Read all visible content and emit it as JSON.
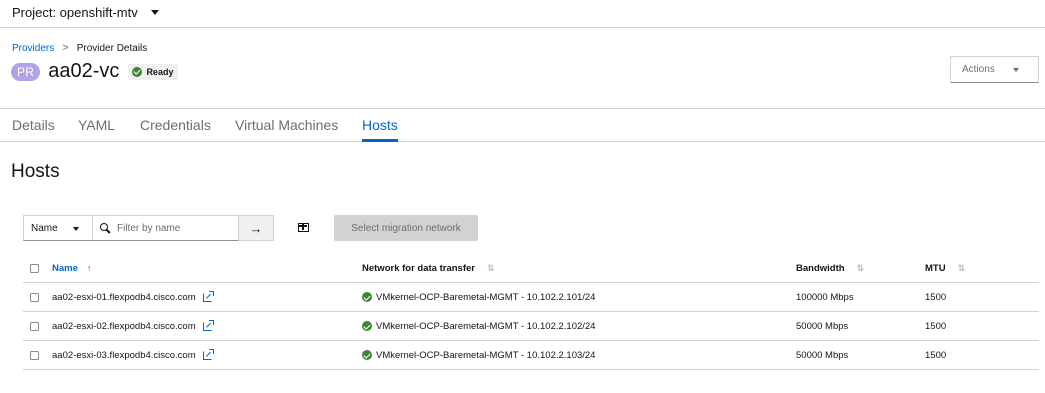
{
  "project": {
    "label": "Project: openshift-mtv"
  },
  "breadcrumb": {
    "link": "Providers",
    "separator": ">",
    "current": "Provider Details"
  },
  "header": {
    "badge": "PR",
    "title": "aa02-vc",
    "status": "Ready",
    "actions_label": "Actions"
  },
  "tabs": [
    {
      "label": "Details"
    },
    {
      "label": "YAML"
    },
    {
      "label": "Credentials"
    },
    {
      "label": "Virtual Machines"
    },
    {
      "label": "Hosts",
      "active": true
    }
  ],
  "section_title": "Hosts",
  "toolbar": {
    "filter_select": "Name",
    "filter_placeholder": "Filter by name",
    "submit_symbol": "→",
    "migrate_button": "Select migration network"
  },
  "table": {
    "columns": [
      "Name",
      "Network for data transfer",
      "Bandwidth",
      "MTU"
    ],
    "rows": [
      {
        "name": "aa02-esxi-01.flexpodb4.cisco.com",
        "network": "VMkernel-OCP-Baremetal-MGMT - 10.102.2.101/24",
        "bandwidth": "100000 Mbps",
        "mtu": "1500"
      },
      {
        "name": "aa02-esxi-02.flexpodb4.cisco.com",
        "network": "VMkernel-OCP-Baremetal-MGMT - 10.102.2.102/24",
        "bandwidth": "50000 Mbps",
        "mtu": "1500"
      },
      {
        "name": "aa02-esxi-03.flexpodb4.cisco.com",
        "network": "VMkernel-OCP-Baremetal-MGMT - 10.102.2.103/24",
        "bandwidth": "50000 Mbps",
        "mtu": "1500"
      }
    ]
  },
  "colors": {
    "accent": "#0066cc",
    "success": "#3e8635",
    "badge": "#b2a3e8"
  }
}
